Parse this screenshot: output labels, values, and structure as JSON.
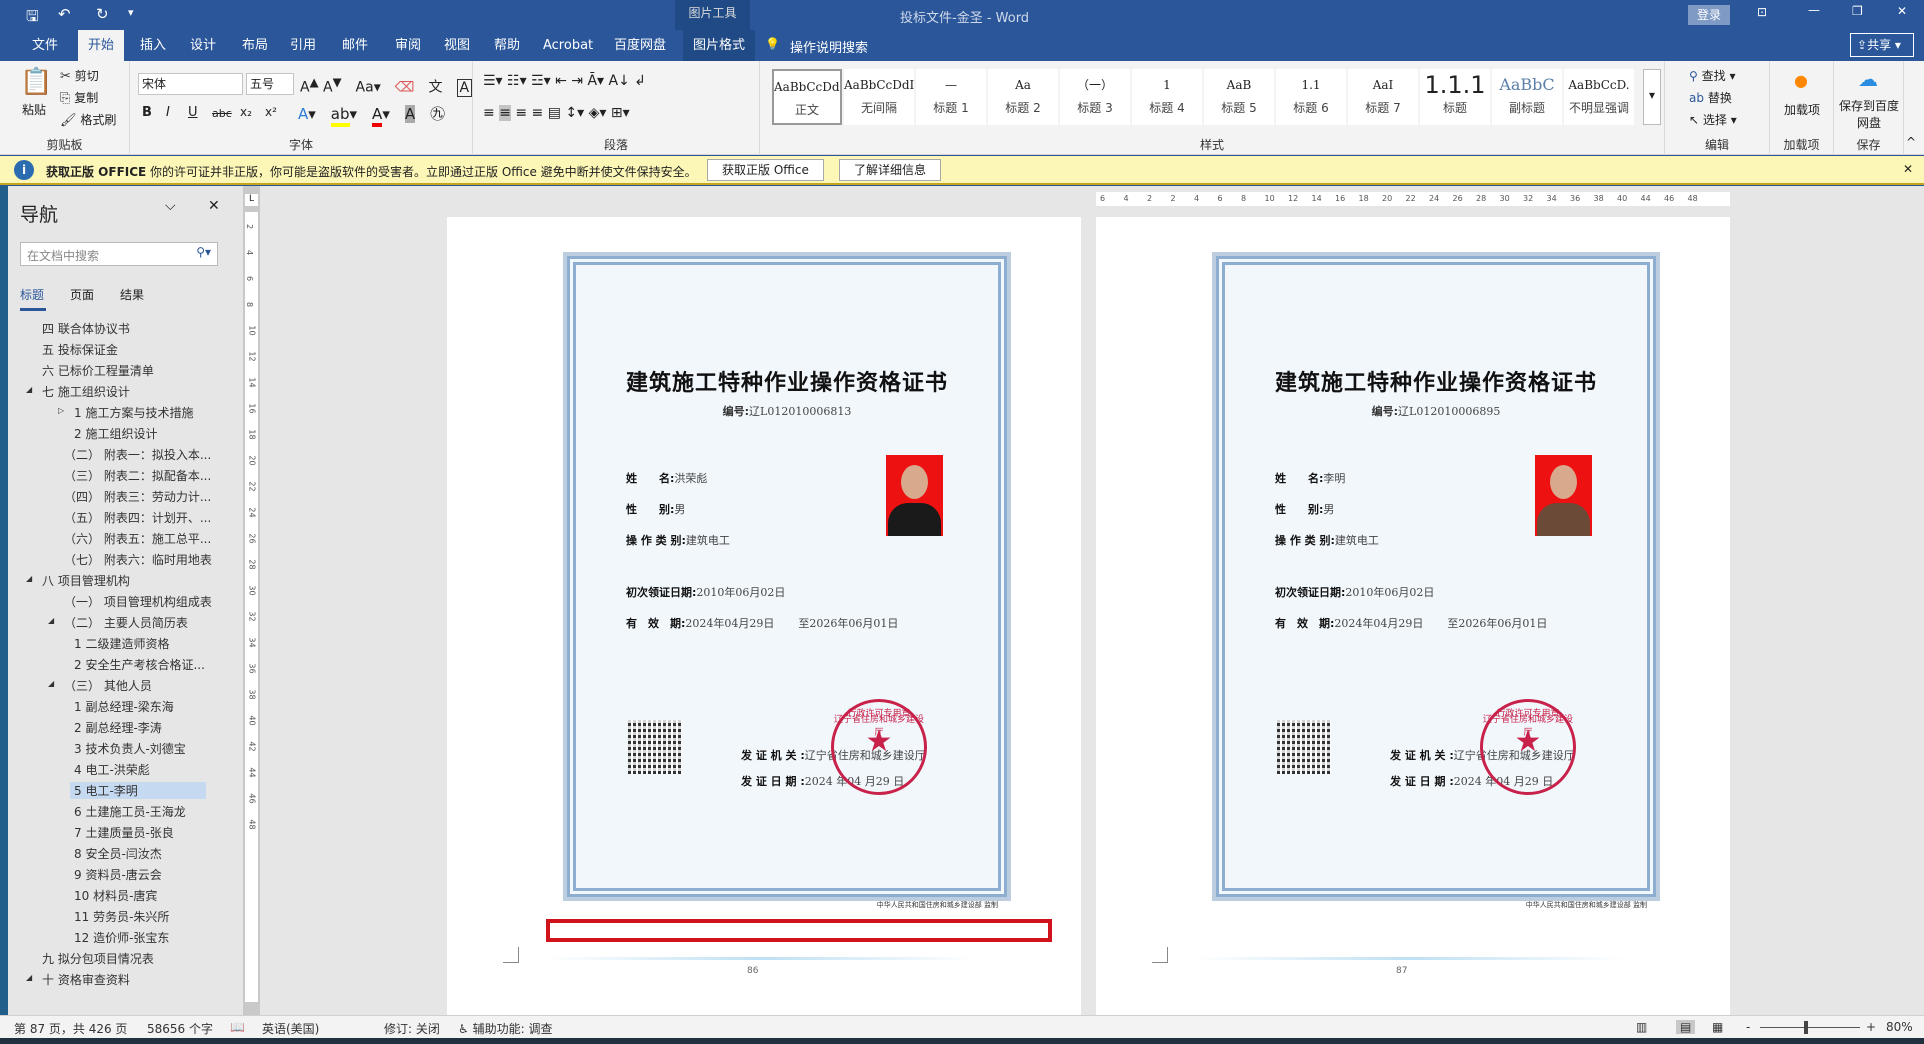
{
  "titlebar": {
    "doc_title": "投标文件-金圣 - Word",
    "context_group": "图片工具",
    "login": "登录"
  },
  "tabs": [
    "文件",
    "开始",
    "插入",
    "设计",
    "布局",
    "引用",
    "邮件",
    "审阅",
    "视图",
    "帮助",
    "Acrobat",
    "百度网盘",
    "图片格式"
  ],
  "tell_me": "操作说明搜索",
  "share": "共享",
  "ribbon": {
    "clipboard": {
      "paste": "粘贴",
      "cut": "剪切",
      "copy": "复制",
      "format_painter": "格式刷",
      "label": "剪贴板"
    },
    "font": {
      "name": "宋体",
      "size": "五号",
      "label": "字体",
      "bold": "B",
      "italic": "I",
      "underline": "U",
      "strike": "abc",
      "sub": "x₂",
      "sup": "x²"
    },
    "paragraph": {
      "label": "段落"
    },
    "styles": {
      "label": "样式",
      "items": [
        {
          "preview": "AaBbCcDdI",
          "name": "正文"
        },
        {
          "preview": "AaBbCcDdI",
          "name": "无间隔"
        },
        {
          "preview": "—",
          "name": "标题 1"
        },
        {
          "preview": "Aa",
          "name": "标题 2"
        },
        {
          "preview": "（一）",
          "name": "标题 3"
        },
        {
          "preview": "1",
          "name": "标题 4"
        },
        {
          "preview": "AaB",
          "name": "标题 5"
        },
        {
          "preview": "1.1",
          "name": "标题 6"
        },
        {
          "preview": "AaI",
          "name": "标题 7"
        },
        {
          "preview": "1.1.1",
          "name": "标题"
        },
        {
          "preview": "AaBbC",
          "name": "副标题"
        },
        {
          "preview": "AaBbCcD.",
          "name": "不明显强调"
        }
      ]
    },
    "editing": {
      "find": "查找",
      "replace": "替换",
      "select": "选择",
      "label": "编辑"
    },
    "addins": {
      "button": "加载项",
      "label": "加载项"
    },
    "save": {
      "button": "保存到百度网盘",
      "label": "保存"
    }
  },
  "infobar": {
    "title": "获取正版 OFFICE",
    "message": "你的许可证并非正版，你可能是盗版软件的受害者。立即通过正版 Office 避免中断并使文件保持安全。",
    "btn1": "获取正版 Office",
    "btn2": "了解详细信息"
  },
  "nav": {
    "title": "导航",
    "search_placeholder": "在文档中搜索",
    "tabs": [
      "标题",
      "页面",
      "结果"
    ],
    "items": [
      {
        "t": "四 联合体协议书",
        "l": 1
      },
      {
        "t": "五 投标保证金",
        "l": 1
      },
      {
        "t": "六 已标价工程量清单",
        "l": 1
      },
      {
        "t": "七 施工组织设计",
        "l": 1,
        "exp": "▲"
      },
      {
        "t": "1 施工方案与技术措施",
        "l": 3,
        "exp": "▷"
      },
      {
        "t": "2 施工组织设计",
        "l": 3
      },
      {
        "t": "（二） 附表一：拟投入本...",
        "l": 2
      },
      {
        "t": "（三） 附表二：拟配备本...",
        "l": 2
      },
      {
        "t": "（四） 附表三：劳动力计...",
        "l": 2
      },
      {
        "t": "（五） 附表四：计划开、...",
        "l": 2
      },
      {
        "t": "（六） 附表五：施工总平...",
        "l": 2
      },
      {
        "t": "（七） 附表六：临时用地表",
        "l": 2
      },
      {
        "t": "八 项目管理机构",
        "l": 1,
        "exp": "▲"
      },
      {
        "t": "（一） 项目管理机构组成表",
        "l": 2
      },
      {
        "t": "（二） 主要人员简历表",
        "l": 2,
        "exp": "▲"
      },
      {
        "t": "1 二级建造师资格",
        "l": 3
      },
      {
        "t": "2 安全生产考核合格证...",
        "l": 3
      },
      {
        "t": "（三） 其他人员",
        "l": 2,
        "exp": "▲"
      },
      {
        "t": "1 副总经理-梁东海",
        "l": 3
      },
      {
        "t": "2 副总经理-李涛",
        "l": 3
      },
      {
        "t": "3 技术负责人-刘德宝",
        "l": 3
      },
      {
        "t": "4 电工-洪荣彪",
        "l": 3
      },
      {
        "t": "5 电工-李明",
        "l": 3,
        "sel": true
      },
      {
        "t": "6 土建施工员-王海龙",
        "l": 3
      },
      {
        "t": "7 土建质量员-张良",
        "l": 3
      },
      {
        "t": "8 安全员-闫汝杰",
        "l": 3
      },
      {
        "t": "9 资料员-唐云会",
        "l": 3
      },
      {
        "t": "10 材料员-唐宾",
        "l": 3
      },
      {
        "t": "11 劳务员-朱兴所",
        "l": 3
      },
      {
        "t": "12 造价师-张宝东",
        "l": 3
      },
      {
        "t": "九 拟分包项目情况表",
        "l": 1
      },
      {
        "t": "十 资格审查资料",
        "l": 1,
        "exp": "▲"
      }
    ]
  },
  "pages": [
    {
      "page_no": "86",
      "cert": {
        "title": "建筑施工特种作业操作资格证书",
        "no_label": "编号:",
        "no": "辽L012010006813",
        "name_label": "姓　　名:",
        "name": "洪荣彪",
        "gender_label": "性　　别:",
        "gender": "男",
        "type_label": "操 作 类 别:",
        "type": "建筑电工",
        "first_label": "初次领证日期:",
        "first": "2010年06月02日",
        "valid_label": "有　效　期:",
        "valid_from": "2024年04月29日",
        "valid_to": "至2026年06月01日",
        "issuer_label": "发 证 机 关 :",
        "issuer": "辽宁省住房和城乡建设厅",
        "issue_date_label": "发 证 日 期 :",
        "issue_date": "2024 年04 月29 日",
        "seal_top": "辽宁省住房和城乡建设厅",
        "seal_bottom": "行政许可专用章",
        "footer": "中华人民共和国住房和城乡建设部 监制",
        "shirt": "#1a1a1a"
      }
    },
    {
      "page_no": "87",
      "cert": {
        "title": "建筑施工特种作业操作资格证书",
        "no_label": "编号:",
        "no": "辽L012010006895",
        "name_label": "姓　　名:",
        "name": "李明",
        "gender_label": "性　　别:",
        "gender": "男",
        "type_label": "操 作 类 别:",
        "type": "建筑电工",
        "first_label": "初次领证日期:",
        "first": "2010年06月02日",
        "valid_label": "有　效　期:",
        "valid_from": "2024年04月29日",
        "valid_to": "至2026年06月01日",
        "issuer_label": "发 证 机 关 :",
        "issuer": "辽宁省住房和城乡建设厅",
        "issue_date_label": "发 证 日 期 :",
        "issue_date": "2024 年04 月29 日",
        "seal_top": "辽宁省住房和城乡建设厅",
        "seal_bottom": "行政许可专用章",
        "footer": "中华人民共和国住房和城乡建设部 监制",
        "shirt": "#6b4a38"
      }
    }
  ],
  "ruler": {
    "h": [
      "6",
      "4",
      "2",
      "2",
      "4",
      "6",
      "8",
      "10",
      "12",
      "14",
      "16",
      "18",
      "20",
      "22",
      "24",
      "26",
      "28",
      "30",
      "32",
      "34",
      "36",
      "38",
      "40",
      "44",
      "46",
      "48"
    ],
    "v": [
      "2",
      "4",
      "6",
      "8",
      "10",
      "12",
      "14",
      "16",
      "18",
      "20",
      "22",
      "24",
      "26",
      "28",
      "30",
      "32",
      "34",
      "36",
      "38",
      "40",
      "42",
      "44",
      "46",
      "48"
    ]
  },
  "status": {
    "page": "第 87 页，共 426 页",
    "words": "58656 个字",
    "lang": "英语(美国)",
    "track": "修订: 关闭",
    "access": "辅助功能: 调查",
    "zoom": "80%"
  },
  "colors": {
    "brand": "#2b579a",
    "highlight": "#c5d9f1",
    "red_box": "#d0121b"
  }
}
